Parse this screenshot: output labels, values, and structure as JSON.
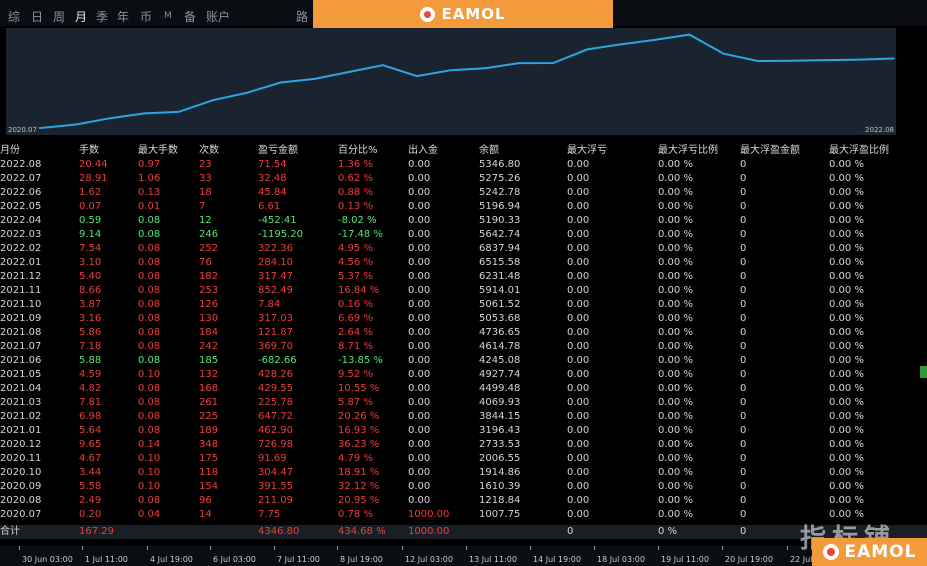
{
  "window": {
    "title_fragment": "...",
    "right_fragment": "..."
  },
  "tabs": [
    {
      "label": "综",
      "active": false
    },
    {
      "label": "日",
      "active": false
    },
    {
      "label": "周",
      "active": false
    },
    {
      "label": "月",
      "active": true
    },
    {
      "label": "季",
      "active": false
    },
    {
      "label": "年",
      "active": false
    },
    {
      "label": "币",
      "active": false
    },
    {
      "label": "M",
      "active": false
    },
    {
      "label": "备",
      "active": false
    },
    {
      "label": "账户",
      "active": false
    }
  ],
  "luji_label": "路",
  "logo": {
    "text": "EAMOL",
    "brand_color": "#f39a3c",
    "mark_color": "#e8463b"
  },
  "watermark": "指标铺",
  "chart_data": {
    "type": "area",
    "title": "",
    "xlabel": "",
    "ylabel": "",
    "x": [
      "2020.07",
      "2020.08",
      "2020.09",
      "2020.10",
      "2020.11",
      "2020.12",
      "2021.01",
      "2021.02",
      "2021.03",
      "2021.04",
      "2021.05",
      "2021.06",
      "2021.07",
      "2021.08",
      "2021.09",
      "2021.10",
      "2021.11",
      "2021.12",
      "2022.01",
      "2022.02",
      "2022.03",
      "2022.04",
      "2022.05",
      "2022.06",
      "2022.07",
      "2022.08"
    ],
    "series": [
      {
        "values": [
          1000,
          1007.75,
          1218.84,
          1610.39,
          1914.86,
          2006.55,
          2733.53,
          3196.43,
          3844.15,
          4069.93,
          4499.48,
          4927.74,
          4245.08,
          4614.78,
          4736.65,
          5053.68,
          5061.52,
          5914.01,
          6231.48,
          6515.58,
          6837.94,
          5642.74,
          5190.33,
          5196.94,
          5242.78,
          5275.26,
          5346.8
        ]
      }
    ],
    "x_axis_labels": {
      "start": "2020.07",
      "end": "2022.08"
    },
    "ylim": [
      1000,
      7000
    ],
    "grid": false,
    "line_color": "#2aa6e0",
    "fill_color": "#1a2430"
  },
  "table": {
    "headers": [
      "月份",
      "手数",
      "最大手数",
      "次数",
      "盈亏金额",
      "百分比%",
      "出入金",
      "余额",
      "最大浮亏",
      "最大浮亏比例",
      "最大浮盈金额",
      "最大浮盈比例"
    ],
    "rows": [
      {
        "sign": "pos",
        "c": [
          "2022.08",
          "20.44",
          "0.97",
          "23",
          "71.54",
          "1.36 %",
          "0.00",
          "5346.80",
          "0.00",
          "0.00 %",
          "0",
          "0.00 %"
        ]
      },
      {
        "sign": "pos",
        "c": [
          "2022.07",
          "28.91",
          "1.06",
          "33",
          "32.48",
          "0.62 %",
          "0.00",
          "5275.26",
          "0.00",
          "0.00 %",
          "0",
          "0.00 %"
        ]
      },
      {
        "sign": "pos",
        "c": [
          "2022.06",
          "1.62",
          "0.13",
          "18",
          "45.84",
          "0.88 %",
          "0.00",
          "5242.78",
          "0.00",
          "0.00 %",
          "0",
          "0.00 %"
        ]
      },
      {
        "sign": "pos",
        "c": [
          "2022.05",
          "0.07",
          "0.01",
          "7",
          "6.61",
          "0.13 %",
          "0.00",
          "5196.94",
          "0.00",
          "0.00 %",
          "0",
          "0.00 %"
        ]
      },
      {
        "sign": "neg",
        "c": [
          "2022.04",
          "0.59",
          "0.08",
          "12",
          "-452.41",
          "-8.02 %",
          "0.00",
          "5190.33",
          "0.00",
          "0.00 %",
          "0",
          "0.00 %"
        ]
      },
      {
        "sign": "neg",
        "c": [
          "2022.03",
          "9.14",
          "0.08",
          "246",
          "-1195.20",
          "-17.48 %",
          "0.00",
          "5642.74",
          "0.00",
          "0.00 %",
          "0",
          "0.00 %"
        ]
      },
      {
        "sign": "pos",
        "c": [
          "2022.02",
          "7.54",
          "0.08",
          "252",
          "322.36",
          "4.95 %",
          "0.00",
          "6837.94",
          "0.00",
          "0.00 %",
          "0",
          "0.00 %"
        ]
      },
      {
        "sign": "pos",
        "c": [
          "2022.01",
          "3.10",
          "0.08",
          "76",
          "284.10",
          "4.56 %",
          "0.00",
          "6515.58",
          "0.00",
          "0.00 %",
          "0",
          "0.00 %"
        ]
      },
      {
        "sign": "pos",
        "c": [
          "2021.12",
          "5.40",
          "0.08",
          "182",
          "317.47",
          "5.37 %",
          "0.00",
          "6231.48",
          "0.00",
          "0.00 %",
          "0",
          "0.00 %"
        ]
      },
      {
        "sign": "pos",
        "c": [
          "2021.11",
          "8.66",
          "0.08",
          "253",
          "852.49",
          "16.84 %",
          "0.00",
          "5914.01",
          "0.00",
          "0.00 %",
          "0",
          "0.00 %"
        ]
      },
      {
        "sign": "pos",
        "c": [
          "2021.10",
          "3.87",
          "0.08",
          "126",
          "7.84",
          "0.16 %",
          "0.00",
          "5061.52",
          "0.00",
          "0.00 %",
          "0",
          "0.00 %"
        ]
      },
      {
        "sign": "pos",
        "c": [
          "2021.09",
          "3.16",
          "0.08",
          "130",
          "317.03",
          "6.69 %",
          "0.00",
          "5053.68",
          "0.00",
          "0.00 %",
          "0",
          "0.00 %"
        ]
      },
      {
        "sign": "pos",
        "c": [
          "2021.08",
          "5.86",
          "0.08",
          "184",
          "121.87",
          "2.64 %",
          "0.00",
          "4736.65",
          "0.00",
          "0.00 %",
          "0",
          "0.00 %"
        ]
      },
      {
        "sign": "pos",
        "c": [
          "2021.07",
          "7.18",
          "0.08",
          "242",
          "369.70",
          "8.71 %",
          "0.00",
          "4614.78",
          "0.00",
          "0.00 %",
          "0",
          "0.00 %"
        ]
      },
      {
        "sign": "neg",
        "c": [
          "2021.06",
          "5.88",
          "0.08",
          "185",
          "-682.66",
          "-13.85 %",
          "0.00",
          "4245.08",
          "0.00",
          "0.00 %",
          "0",
          "0.00 %"
        ]
      },
      {
        "sign": "pos",
        "c": [
          "2021.05",
          "4.59",
          "0.10",
          "132",
          "428.26",
          "9.52 %",
          "0.00",
          "4927.74",
          "0.00",
          "0.00 %",
          "0",
          "0.00 %"
        ]
      },
      {
        "sign": "pos",
        "c": [
          "2021.04",
          "4.82",
          "0.08",
          "168",
          "429.55",
          "10.55 %",
          "0.00",
          "4499.48",
          "0.00",
          "0.00 %",
          "0",
          "0.00 %"
        ]
      },
      {
        "sign": "pos",
        "c": [
          "2021.03",
          "7.81",
          "0.08",
          "261",
          "225.78",
          "5.87 %",
          "0.00",
          "4069.93",
          "0.00",
          "0.00 %",
          "0",
          "0.00 %"
        ]
      },
      {
        "sign": "pos",
        "c": [
          "2021.02",
          "6.98",
          "0.08",
          "225",
          "647.72",
          "20.26 %",
          "0.00",
          "3844.15",
          "0.00",
          "0.00 %",
          "0",
          "0.00 %"
        ]
      },
      {
        "sign": "pos",
        "c": [
          "2021.01",
          "5.64",
          "0.08",
          "189",
          "462.90",
          "16.93 %",
          "0.00",
          "3196.43",
          "0.00",
          "0.00 %",
          "0",
          "0.00 %"
        ]
      },
      {
        "sign": "pos",
        "c": [
          "2020.12",
          "9.65",
          "0.14",
          "348",
          "726.98",
          "36.23 %",
          "0.00",
          "2733.53",
          "0.00",
          "0.00 %",
          "0",
          "0.00 %"
        ]
      },
      {
        "sign": "pos",
        "c": [
          "2020.11",
          "4.67",
          "0.10",
          "175",
          "91.69",
          "4.79 %",
          "0.00",
          "2006.55",
          "0.00",
          "0.00 %",
          "0",
          "0.00 %"
        ]
      },
      {
        "sign": "pos",
        "c": [
          "2020.10",
          "3.44",
          "0.10",
          "118",
          "304.47",
          "18.91 %",
          "0.00",
          "1914.86",
          "0.00",
          "0.00 %",
          "0",
          "0.00 %"
        ]
      },
      {
        "sign": "pos",
        "c": [
          "2020.09",
          "5.58",
          "0.10",
          "154",
          "391.55",
          "32.12 %",
          "0.00",
          "1610.39",
          "0.00",
          "0.00 %",
          "0",
          "0.00 %"
        ]
      },
      {
        "sign": "pos",
        "c": [
          "2020.08",
          "2.49",
          "0.08",
          "96",
          "211.09",
          "20.95 %",
          "0.00",
          "1218.84",
          "0.00",
          "0.00 %",
          "0",
          "0.00 %"
        ]
      },
      {
        "sign": "pos",
        "c": [
          "2020.07",
          "0.20",
          "0.04",
          "14",
          "7.75",
          "0.78 %",
          "1000.00",
          "1007.75",
          "0.00",
          "0.00 %",
          "0",
          "0.00 %"
        ]
      }
    ],
    "total": {
      "label": "合计",
      "lots": "167.29",
      "pnl": "4346.80",
      "pct": "434.68 %",
      "deposit": "1000.00",
      "max_dd": "0",
      "max_dd_pct": "0 %",
      "max_fp": "0"
    }
  },
  "timebar": [
    "30 Jun 03:00",
    "1 Jul 11:00",
    "4 Jul 19:00",
    "6 Jul 03:00",
    "7 Jul 11:00",
    "8 Jul 19:00",
    "12 Jul 03:00",
    "13 Jul 11:00",
    "14 Jul 19:00",
    "18 Jul 03:00",
    "19 Jul 11:00",
    "20 Jul 19:00",
    "22 Jul 03:00"
  ],
  "colors": {
    "positive": "#e8403c",
    "negative": "#57e37a",
    "text": "#cfd6dc",
    "chart_line": "#2aa6e0"
  }
}
